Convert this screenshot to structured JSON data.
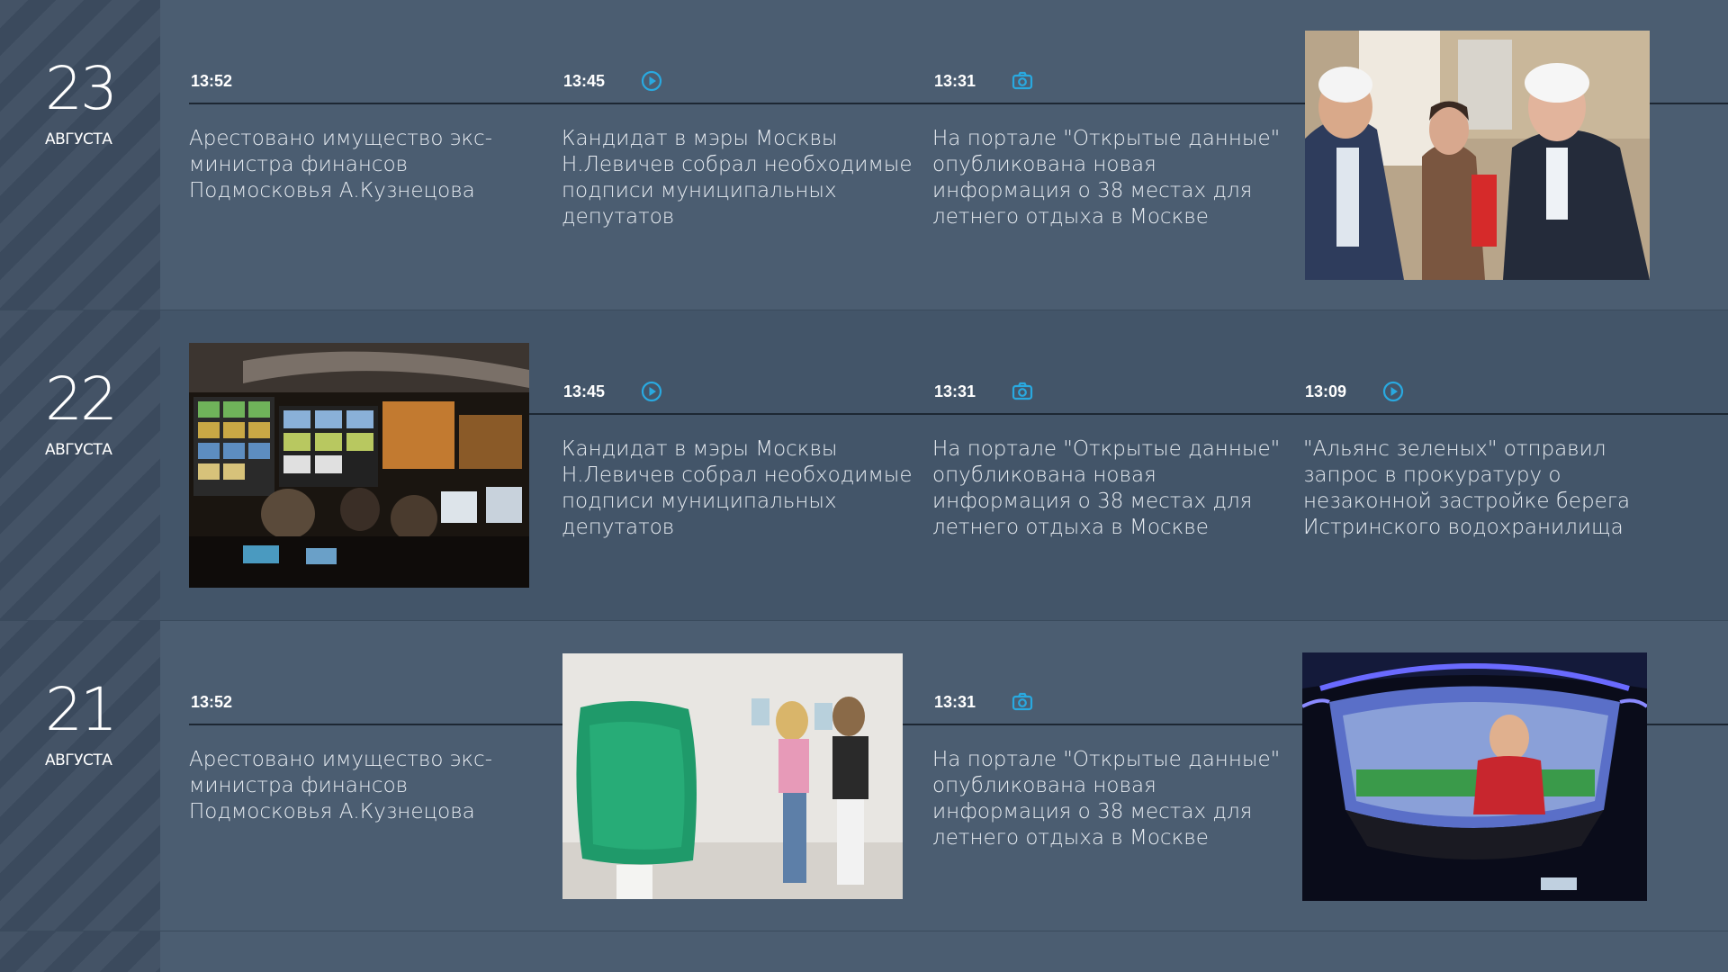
{
  "accent": "#29a9e0",
  "days": [
    {
      "day": "23",
      "month": "АВГУСТА",
      "items": [
        {
          "time": "13:52",
          "icon": "",
          "title": "Арестовано имущество экс-министра финансов Подмосковья А.Кузнецова"
        },
        {
          "time": "13:45",
          "icon": "play-icon",
          "title": "Кандидат в мэры Москвы Н.Левичев собрал необходимые подписи муниципальных депутатов"
        },
        {
          "time": "13:31",
          "icon": "camera-icon",
          "title": "На портале \"Открытые данные\" опубликована новая информация о 38 местах для летнего отдыха в Москве"
        }
      ]
    },
    {
      "day": "22",
      "month": "АВГУСТА",
      "items": [
        {
          "time": "13:45",
          "icon": "play-icon",
          "title": "Кандидат в мэры Москвы Н.Левичев собрал необходимые подписи муниципальных депутатов"
        },
        {
          "time": "13:31",
          "icon": "camera-icon",
          "title": "На портале \"Открытые данные\" опубликована новая информация о 38 местах для летнего отдыха в Москве"
        },
        {
          "time": "13:09",
          "icon": "play-icon",
          "title": "\"Альянс зеленых\" отправил запрос в прокуратуру о незаконной застройке берега Истринского водохранилища"
        }
      ]
    },
    {
      "day": "21",
      "month": "АВГУСТА",
      "items": [
        {
          "time": "13:52",
          "icon": "",
          "title": "Арестовано имущество экс-министра финансов Подмосковья А.Кузнецова"
        },
        {
          "time": "13:31",
          "icon": "camera-icon",
          "title": "На портале \"Открытые данные\" опубликована новая информация о 38 местах для летнего отдыха в Москве"
        }
      ]
    }
  ]
}
